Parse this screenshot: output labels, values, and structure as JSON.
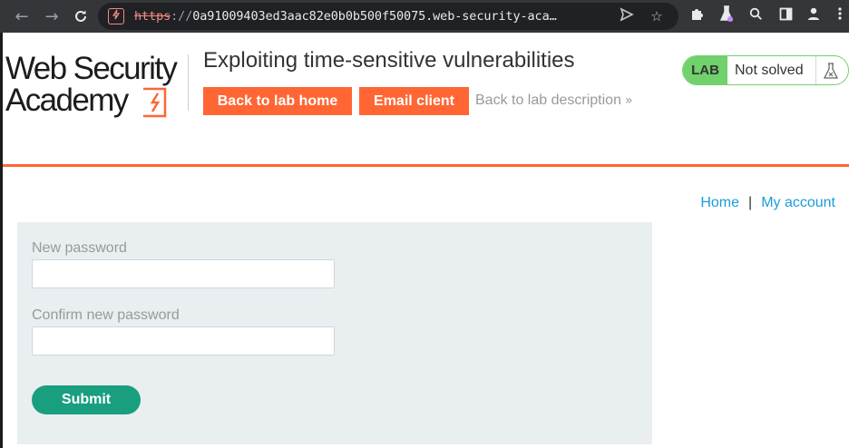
{
  "browser": {
    "back_glyph": "←",
    "forward_glyph": "→",
    "reload_glyph": "⟳",
    "url_scheme": "https",
    "url_separator": "://",
    "url_host": "0a91009403ed3aac82e0b0b500f50075.web-security-aca…",
    "icons": [
      "back-icon",
      "forward-icon",
      "reload-icon",
      "not-secure-icon",
      "send-icon",
      "bookmark-star-icon",
      "extensions-icon",
      "lab-flask-icon",
      "search-icon",
      "side-panel-icon",
      "profile-icon",
      "menu-icon"
    ]
  },
  "header": {
    "logo_line1": "Web Security",
    "logo_line2": "Academy",
    "lab_title": "Exploiting time-sensitive vulnerabilities",
    "back_to_lab_home": "Back to lab home",
    "email_client": "Email client",
    "back_to_description": "Back to lab description",
    "description_chevron": "»"
  },
  "status": {
    "badge": "LAB",
    "text": "Not solved",
    "flask_icon": "flask-icon"
  },
  "topnav": {
    "home": "Home",
    "separator": "|",
    "my_account": "My account"
  },
  "form": {
    "new_password_label": "New password",
    "new_password_value": "",
    "confirm_password_label": "Confirm new password",
    "confirm_password_value": "",
    "submit_label": "Submit"
  },
  "colors": {
    "accent_orange": "#ff6633",
    "lab_green": "#70d16d",
    "submit_green": "#199e7e",
    "link_blue": "#1a9dd9",
    "panel_bg": "#e9eef1",
    "chrome_bg": "#35363a",
    "omnibox_bg": "#202124",
    "insecure_red": "#f28b82"
  }
}
